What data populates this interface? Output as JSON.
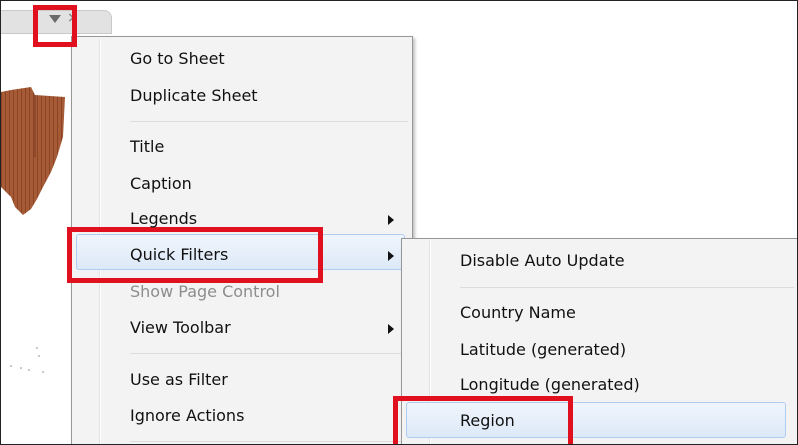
{
  "tab": {
    "dropdown_icon": "chevron-down-icon",
    "close_icon": "close-icon",
    "close_glyph": "×"
  },
  "context_menu": {
    "items": [
      {
        "label": "Go to Sheet"
      },
      {
        "label": "Duplicate Sheet"
      },
      {
        "label": "Title"
      },
      {
        "label": "Caption"
      },
      {
        "label": "Legends",
        "submenu": true
      },
      {
        "label": "Quick Filters",
        "submenu": true,
        "highlighted": true
      },
      {
        "label": "Show Page Control",
        "disabled": true
      },
      {
        "label": "View Toolbar",
        "submenu": true
      },
      {
        "label": "Use as Filter"
      },
      {
        "label": "Ignore Actions"
      }
    ]
  },
  "submenu": {
    "items": [
      {
        "label": "Disable Auto Update"
      },
      {
        "label": "Country Name"
      },
      {
        "label": "Latitude (generated)"
      },
      {
        "label": "Longitude (generated)"
      },
      {
        "label": "Region",
        "highlighted": true
      }
    ]
  },
  "colors": {
    "map_fill": "#a65a36",
    "highlight_border": "#e0101e",
    "menu_bg": "#f3f3f3"
  }
}
